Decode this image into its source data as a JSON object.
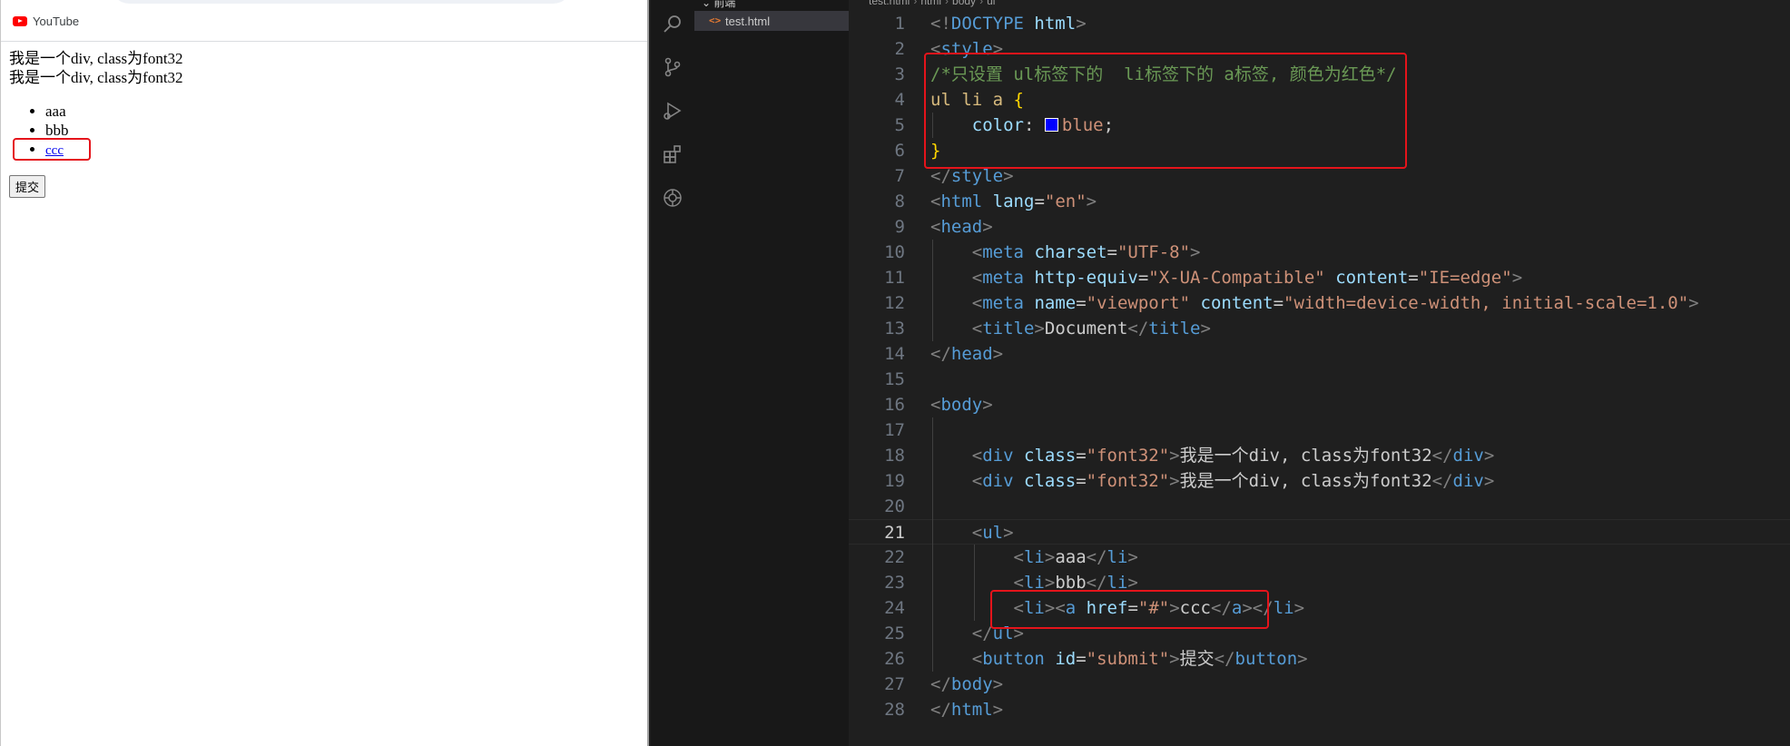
{
  "browser": {
    "bookmark": {
      "label": "YouTube"
    },
    "page": {
      "div1": "我是一个div, class为font32",
      "div2": "我是一个div, class为font32",
      "list": [
        "aaa",
        "bbb",
        "ccc"
      ],
      "submit_label": "提交"
    }
  },
  "explorer": {
    "folder_label": "前端",
    "file": "test.html"
  },
  "breadcrumb": [
    "test.html",
    "html",
    "body",
    "ul"
  ],
  "editor": {
    "active_line": 21,
    "swatch_color": "#0000ff",
    "lines": [
      {
        "n": "1",
        "t": "<!DOCTYPE html>"
      },
      {
        "n": "2",
        "t": "<style>"
      },
      {
        "n": "3",
        "t": "/*只设置 ul标签下的  li标签下的 a标签, 颜色为红色*/"
      },
      {
        "n": "4",
        "t": "ul li a {"
      },
      {
        "n": "5",
        "t": "    color: blue;"
      },
      {
        "n": "6",
        "t": "}"
      },
      {
        "n": "7",
        "t": "</style>"
      },
      {
        "n": "8",
        "t": "<html lang=\"en\">"
      },
      {
        "n": "9",
        "t": "<head>"
      },
      {
        "n": "10",
        "t": "    <meta charset=\"UTF-8\">"
      },
      {
        "n": "11",
        "t": "    <meta http-equiv=\"X-UA-Compatible\" content=\"IE=edge\">"
      },
      {
        "n": "12",
        "t": "    <meta name=\"viewport\" content=\"width=device-width, initial-scale=1.0\">"
      },
      {
        "n": "13",
        "t": "    <title>Document</title>"
      },
      {
        "n": "14",
        "t": "</head>"
      },
      {
        "n": "15",
        "t": ""
      },
      {
        "n": "16",
        "t": "<body>"
      },
      {
        "n": "17",
        "t": ""
      },
      {
        "n": "18",
        "t": "    <div class=\"font32\">我是一个div, class为font32</div>"
      },
      {
        "n": "19",
        "t": "    <div class=\"font32\">我是一个div, class为font32</div>"
      },
      {
        "n": "20",
        "t": ""
      },
      {
        "n": "21",
        "t": "    <ul>"
      },
      {
        "n": "22",
        "t": "        <li>aaa</li>"
      },
      {
        "n": "23",
        "t": "        <li>bbb</li>"
      },
      {
        "n": "24",
        "t": "        <li><a href=\"#\">ccc</a></li>"
      },
      {
        "n": "25",
        "t": "    </ul>"
      },
      {
        "n": "26",
        "t": "    <button id=\"submit\">提交</button>"
      },
      {
        "n": "27",
        "t": "</body>"
      },
      {
        "n": "28",
        "t": "</html>"
      }
    ]
  }
}
